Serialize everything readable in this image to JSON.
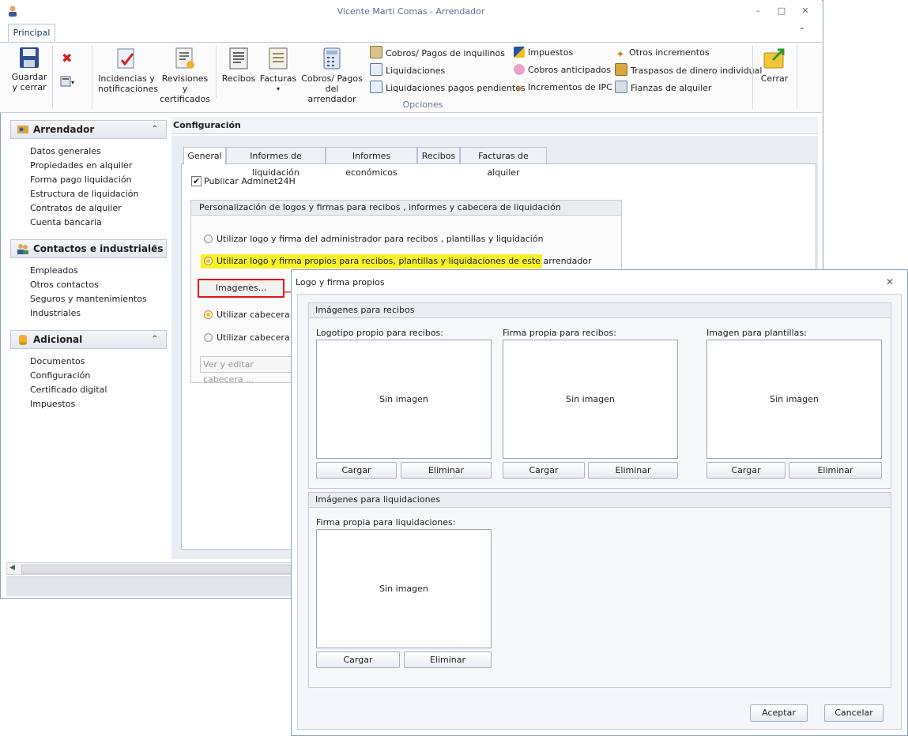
{
  "window": {
    "title": "Vicente Marti Comas - Arrendador",
    "min": "–",
    "max": "□",
    "close": "✕"
  },
  "ribbon": {
    "tab": "Principal",
    "group_label": "Opciones",
    "buttons": [
      {
        "label1": "Guardar",
        "label2": "y cerrar"
      },
      {
        "label1": "Incidencias y",
        "label2": "notificaciones"
      },
      {
        "label1": "Revisiones y",
        "label2": "certificados"
      },
      {
        "label1": "Recibos",
        "label2": ""
      },
      {
        "label1": "Facturas",
        "label2": "▾"
      },
      {
        "label1": "Cobros/ Pagos",
        "label2": "del arrendador"
      },
      {
        "label1": "Cerrar",
        "label2": ""
      }
    ],
    "small_col1": [
      "Cobros/ Pagos de inquilinos",
      "Liquidaciones",
      "Liquidaciones pagos pendientes"
    ],
    "small_col2": [
      "Impuestos",
      "Cobros anticipados",
      "Incrementos de IPC"
    ],
    "small_col3": [
      "Otros incrementos",
      "Traspasos de dinero individual",
      "Fianzas de alquiler"
    ]
  },
  "nav": {
    "sections": [
      {
        "title": "Arrendador",
        "items": [
          "Datos generales",
          "Propiedades en alquiler",
          "Forma pago liquidación",
          "Estructura de liquidación",
          "Contratos de alquiler",
          "Cuenta bancaria"
        ]
      },
      {
        "title": "Contactos e industriales",
        "items": [
          "Empleados",
          "Otros contactos",
          "Seguros y mantenimientos",
          "Industriales"
        ]
      },
      {
        "title": "Adicional",
        "items": [
          "Documentos",
          "Configuración",
          "Certificado digital",
          "Impuestos"
        ]
      }
    ]
  },
  "config": {
    "title": "Configuración",
    "tabs": [
      "General",
      "Informes de liquidación",
      "Informes económicos",
      "Recibos",
      "Facturas de alquiler"
    ],
    "publish_label": "Publicar Adminet24H",
    "group_title": "Personalización de logos y firmas para recibos , informes y cabecera de liquidación",
    "radio1": "Utilizar logo y firma del administrador para recibos , plantillas y liquidación",
    "radio2": "Utilizar logo y firma propios para recibos, plantillas y liquidaciones de este arrendador",
    "images_button": "Imagenes...",
    "radio3": "Utilizar cabecera y p",
    "radio4": "Utilizar cabecera y p",
    "edit_field": "Ver y editar cabecera ..."
  },
  "dialog": {
    "title": "Logo y firma propios",
    "close": "✕",
    "group1": "Imágenes para recibos",
    "group2": "Imágenes para liquidaciones",
    "no_image": "Sin imagen",
    "load": "Cargar",
    "delete": "Eliminar",
    "labels": [
      "Logotipo propio para recibos:",
      "Firma propia para recibos:",
      "Imagen para plantillas:",
      "Firma propia para liquidaciones:"
    ],
    "ok": "Aceptar",
    "cancel": "Cancelar"
  },
  "colors": {
    "highlight": "#f7f227",
    "annotation": "#e01a1a"
  }
}
